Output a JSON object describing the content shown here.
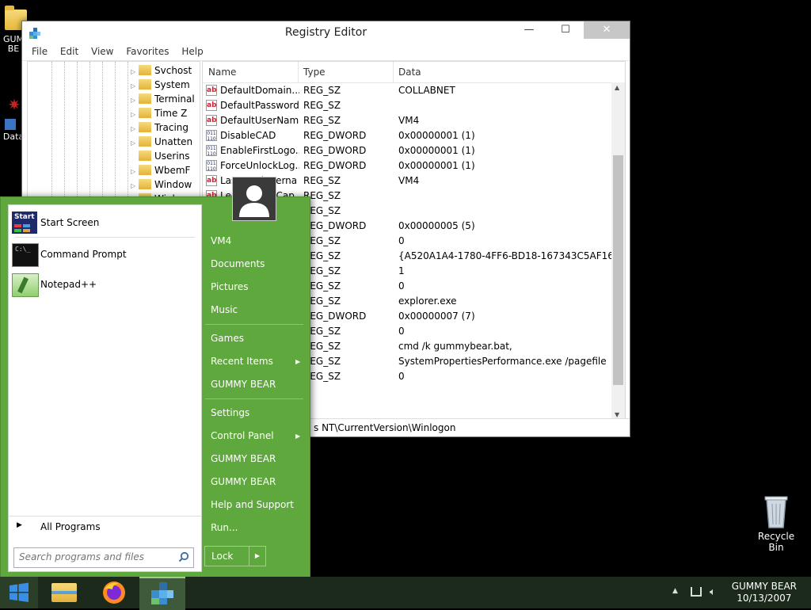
{
  "desktop": {
    "icons": [
      {
        "label": "GUM\nBE"
      },
      {
        "label": "Data"
      },
      {
        "label": "Recycle\nBin"
      }
    ]
  },
  "regedit": {
    "title": "Registry Editor",
    "menu": [
      "File",
      "Edit",
      "View",
      "Favorites",
      "Help"
    ],
    "tree": [
      "Svchost",
      "System",
      "Terminal",
      "Time Z",
      "Tracing",
      "Unatten",
      "Userins",
      "WbemF",
      "Window",
      "Winl"
    ],
    "columns": {
      "name": "Name",
      "type": "Type",
      "data": "Data"
    },
    "rows": [
      {
        "name": "DefaultDomain...",
        "type": "REG_SZ",
        "data": "COLLABNET",
        "icon": "sz"
      },
      {
        "name": "DefaultPassword",
        "type": "REG_SZ",
        "data": "",
        "icon": "sz"
      },
      {
        "name": "DefaultUserName",
        "type": "REG_SZ",
        "data": "VM4",
        "icon": "sz"
      },
      {
        "name": "DisableCAD",
        "type": "REG_DWORD",
        "data": "0x00000001 (1)",
        "icon": "dw"
      },
      {
        "name": "EnableFirstLogo...",
        "type": "REG_DWORD",
        "data": "0x00000001 (1)",
        "icon": "dw"
      },
      {
        "name": "ForceUnlockLog...",
        "type": "REG_DWORD",
        "data": "0x00000001 (1)",
        "icon": "dw"
      },
      {
        "name": "LastUsedUserna",
        "type": "REG_SZ",
        "data": "VM4",
        "icon": "sz"
      },
      {
        "name": "LegalNoticeCap",
        "type": "REG_SZ",
        "data": "",
        "icon": "sz"
      },
      {
        "name": "",
        "type": "REG_SZ",
        "data": "",
        "icon": "sz"
      },
      {
        "name": "",
        "type": "REG_DWORD",
        "data": "0x00000005 (5)",
        "icon": "dw"
      },
      {
        "name": "",
        "type": "REG_SZ",
        "data": "0",
        "icon": "sz"
      },
      {
        "name": "",
        "type": "REG_SZ",
        "data": "{A520A1A4-1780-4FF6-BD18-167343C5AF16}",
        "icon": "sz"
      },
      {
        "name": "",
        "type": "REG_SZ",
        "data": "1",
        "icon": "sz"
      },
      {
        "name": "",
        "type": "REG_SZ",
        "data": "0",
        "icon": "sz"
      },
      {
        "name": "",
        "type": "REG_SZ",
        "data": "explorer.exe",
        "icon": "sz"
      },
      {
        "name": "",
        "type": "REG_DWORD",
        "data": "0x00000007 (7)",
        "icon": "dw"
      },
      {
        "name": "",
        "type": "REG_SZ",
        "data": "0",
        "icon": "sz"
      },
      {
        "name": "",
        "type": "REG_SZ",
        "data": "cmd /k gummybear.bat,",
        "icon": "sz"
      },
      {
        "name": "",
        "type": "REG_SZ",
        "data": "SystemPropertiesPerformance.exe /pagefile",
        "icon": "sz"
      },
      {
        "name": "",
        "type": "REG_SZ",
        "data": "0",
        "icon": "sz"
      }
    ],
    "status_path": "Computer\\HKEY_LOCAL_MACHINE\\SOFTWARE\\Microsoft\\Windows NT\\CurrentVersion\\Winlogon",
    "status_visible": "s NT\\CurrentVersion\\Winlogon"
  },
  "startmenu": {
    "pinned": [
      {
        "label": "Start Screen",
        "icon": "start-screen-icon"
      },
      {
        "label": "Command Prompt",
        "icon": "command-prompt-icon"
      },
      {
        "label": "Notepad++",
        "icon": "notepad-plus-plus-icon"
      }
    ],
    "all_programs": "All Programs",
    "search_placeholder": "Search programs and files",
    "right_links": [
      {
        "label": "VM4"
      },
      {
        "label": "Documents"
      },
      {
        "label": "Pictures"
      },
      {
        "label": "Music"
      },
      {
        "label": "Games"
      },
      {
        "label": "Recent Items",
        "has_submenu": true
      },
      {
        "label": "GUMMY BEAR"
      },
      {
        "label": "Settings"
      },
      {
        "label": "Control Panel",
        "has_submenu": true
      },
      {
        "label": "GUMMY BEAR"
      },
      {
        "label": "GUMMY BEAR"
      },
      {
        "label": "Help and Support"
      },
      {
        "label": "Run..."
      }
    ],
    "lock_label": "Lock"
  },
  "taskbar": {
    "tray_name": "GUMMY BEAR",
    "tray_date": "10/13/2007",
    "colors": {
      "taskbar": "#1b2a1a",
      "start_menu": "#5fa83d"
    }
  }
}
